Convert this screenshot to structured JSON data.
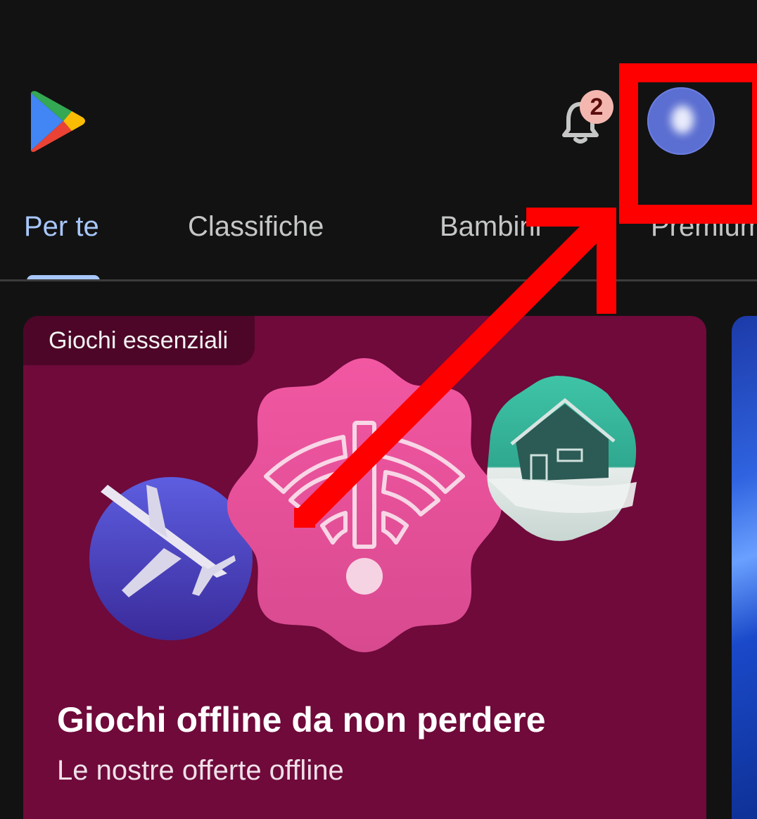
{
  "header": {
    "app_logo": "google-play-logo",
    "notification_count": "2",
    "avatar": "account-avatar"
  },
  "tabs": [
    {
      "label": "Per te",
      "active": true
    },
    {
      "label": "Classifiche",
      "active": false
    },
    {
      "label": "Bambini",
      "active": false
    },
    {
      "label": "Premium",
      "active": false
    }
  ],
  "card": {
    "chip": "Giochi essenziali",
    "title": "Giochi offline da non perdere",
    "subtitle": "Le nostre offerte offline"
  },
  "colors": {
    "background": "#121212",
    "active_tab": "#a8c7fa",
    "card_bg": "#6f0a3a",
    "annotation_red": "#ff0000",
    "avatar_blue": "#5b6ed1"
  },
  "annotation": {
    "type": "red-box-with-arrow",
    "target": "account-avatar"
  }
}
